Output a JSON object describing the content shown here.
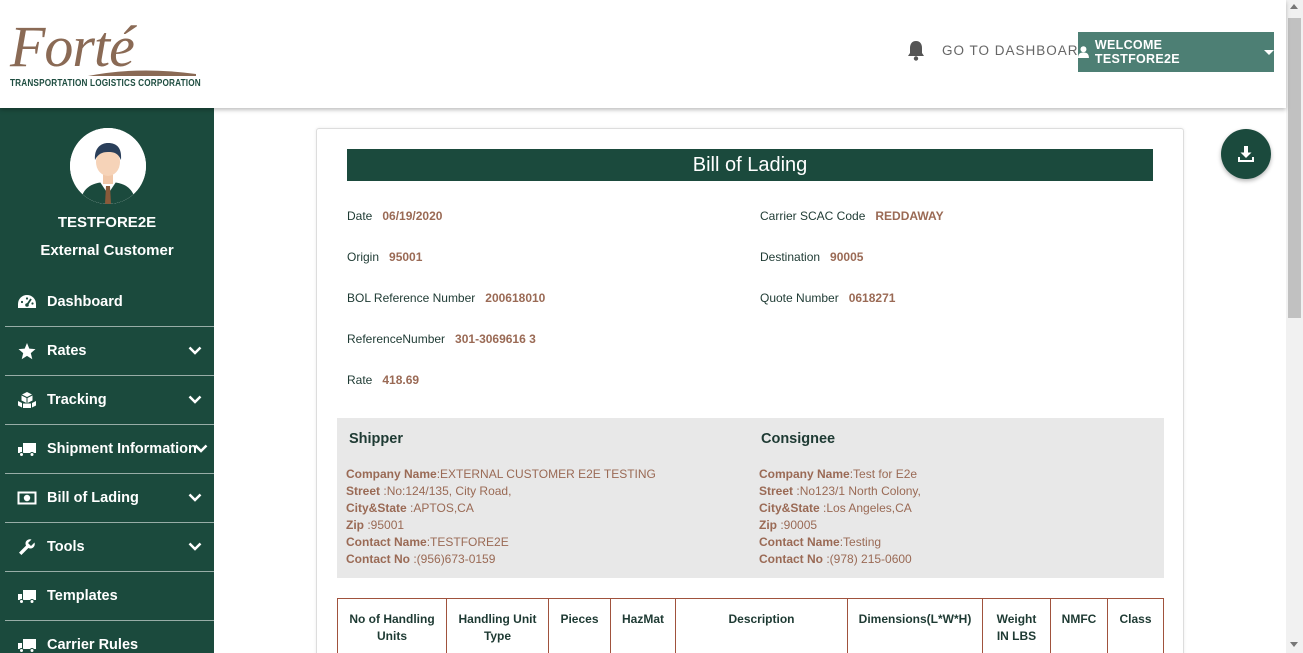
{
  "header": {
    "logo_word": "Forté",
    "logo_subtitle": "TRANSPORTATION LOGISTICS CORPORATION",
    "goto_dashboard": "GO TO DASHBOARD",
    "welcome": "WELCOME TESTFORE2E"
  },
  "sidebar": {
    "user_name": "TESTFORE2E",
    "user_role": "External Customer",
    "items": [
      {
        "label": "Dashboard",
        "icon": "dashboard-icon",
        "expandable": false
      },
      {
        "label": "Rates",
        "icon": "star-icon",
        "expandable": true
      },
      {
        "label": "Tracking",
        "icon": "boxes-icon",
        "expandable": true
      },
      {
        "label": "Shipment Information",
        "icon": "truck-icon",
        "expandable": true
      },
      {
        "label": "Bill of Lading",
        "icon": "money-bill-icon",
        "expandable": true
      },
      {
        "label": "Tools",
        "icon": "wrench-icon",
        "expandable": true
      },
      {
        "label": "Templates",
        "icon": "truck-icon",
        "expandable": false
      },
      {
        "label": "Carrier Rules",
        "icon": "truck-icon",
        "expandable": false
      }
    ]
  },
  "bol": {
    "title": "Bill of Lading",
    "date_label": "Date",
    "date": "06/19/2020",
    "scac_label": "Carrier SCAC Code",
    "scac": "REDDAWAY",
    "origin_label": "Origin",
    "origin": "95001",
    "destination_label": "Destination",
    "destination": "90005",
    "bol_ref_label": "BOL Reference Number",
    "bol_ref": "200618010",
    "quote_label": "Quote Number",
    "quote": "0618271",
    "ref_label": "ReferenceNumber",
    "ref": "301-3069616 3",
    "rate_label": "Rate",
    "rate": "418.69"
  },
  "shipper": {
    "heading": "Shipper",
    "company_label": "Company Name",
    "company": "EXTERNAL CUSTOMER E2E TESTING",
    "street_label": "Street",
    "street": "No:124/135, City Road,",
    "citystate_label": "City&State",
    "citystate": "APTOS,CA",
    "zip_label": "Zip",
    "zip": "95001",
    "contact_name_label": "Contact Name",
    "contact_name": "TESTFORE2E",
    "contact_no_label": "Contact No",
    "contact_no": "(956)673-0159"
  },
  "consignee": {
    "heading": "Consignee",
    "company_label": "Company Name",
    "company": "Test for E2e",
    "street_label": "Street",
    "street": "No123/1 North Colony,",
    "citystate_label": "City&State",
    "citystate": "Los Angeles,CA",
    "zip_label": "Zip",
    "zip": "90005",
    "contact_name_label": "Contact Name",
    "contact_name": "Testing",
    "contact_no_label": "Contact No",
    "contact_no": "(978) 215-0600"
  },
  "table": {
    "headers": [
      "No of Handling Units",
      "Handling Unit Type",
      "Pieces",
      "HazMat",
      "Description",
      "Dimensions(L*W*H)",
      "Weight IN LBS",
      "NMFC",
      "Class"
    ]
  },
  "colors": {
    "brand_green": "#1b4a3d",
    "accent_brown": "#9a6a55",
    "welcome_bg": "#4d7f74"
  }
}
